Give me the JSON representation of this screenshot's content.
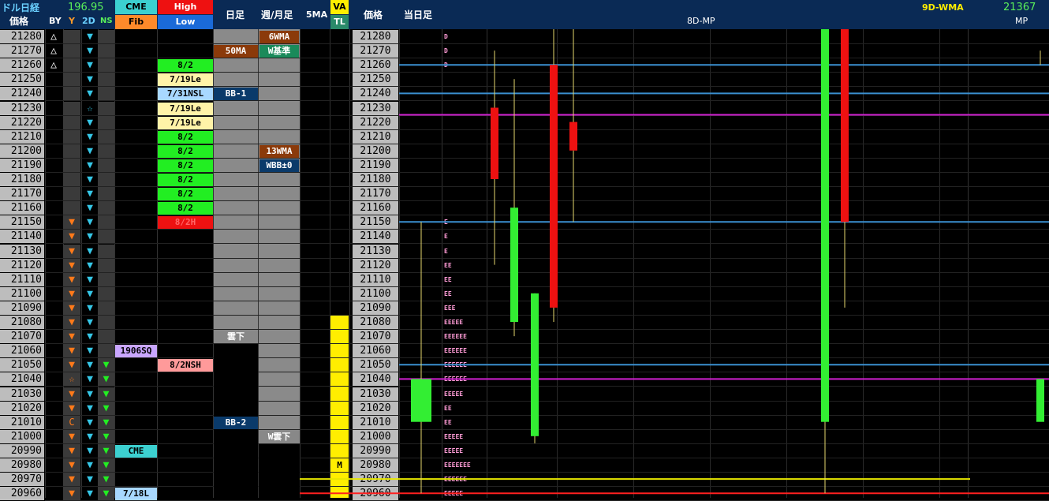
{
  "header": {
    "title": "ドル日経",
    "rate": "196.95",
    "price_label": "価格",
    "by_label": "BY",
    "y_label": "Y",
    "two_d_label": "2D",
    "ns_label": "NS",
    "cme_label": "CME",
    "fib_label": "Fib",
    "high_label": "High",
    "low_label": "Low",
    "daily_label": "日足",
    "weekly_label": "週/月足",
    "ma5_label": "5MA",
    "va_label": "VA",
    "tl_label": "TL",
    "price_label2": "価格",
    "today_label": "当日足",
    "mp8d_label": "8D-MP",
    "wma9d_label": "9D-WMA",
    "mp_value": "21367",
    "mp_label": "MP"
  },
  "prices": [
    "21280",
    "21270",
    "21260",
    "21250",
    "21240",
    "21230",
    "21220",
    "21210",
    "21200",
    "21190",
    "21180",
    "21170",
    "21160",
    "21150",
    "21140",
    "21130",
    "21120",
    "21110",
    "21100",
    "21090",
    "21080",
    "21070",
    "21060",
    "21050",
    "21040",
    "21030",
    "21020",
    "21010",
    "21000",
    "20990",
    "20980",
    "20970",
    "20960"
  ],
  "by_col": [
    "△",
    "△",
    "△",
    "",
    "",
    "",
    "",
    "",
    "",
    "",
    "",
    "",
    "",
    "",
    "",
    "",
    "",
    "",
    "",
    "",
    "",
    "",
    "",
    "",
    "",
    "",
    "",
    "",
    "",
    "",
    "",
    "",
    ""
  ],
  "y_col": [
    "",
    "",
    "",
    "",
    "",
    "",
    "",
    "",
    "",
    "",
    "",
    "",
    "",
    "▼",
    "▼",
    "▼",
    "▼",
    "▼",
    "▼",
    "▼",
    "▼",
    "▼",
    "▼",
    "▼",
    "☆",
    "▼",
    "▼",
    "C",
    "▼",
    "▼",
    "▼",
    "▼",
    "▼"
  ],
  "d2_col": [
    "▼",
    "▼",
    "▼",
    "▼",
    "▼",
    "☆",
    "▼",
    "▼",
    "▼",
    "▼",
    "▼",
    "▼",
    "▼",
    "▼",
    "▼",
    "▼",
    "▼",
    "▼",
    "▼",
    "▼",
    "▼",
    "▼",
    "▼",
    "▼",
    "▼",
    "▼",
    "▼",
    "▼",
    "▼",
    "▼",
    "▼",
    "▼",
    "▼"
  ],
  "ns_col": [
    "",
    "",
    "",
    "",
    "",
    "",
    "",
    "",
    "",
    "",
    "",
    "",
    "",
    "",
    "",
    "",
    "",
    "",
    "",
    "",
    "",
    "",
    "",
    "▼",
    "▼",
    "▼",
    "▼",
    "▼",
    "▼",
    "▼",
    "▼",
    "▼",
    "▼"
  ],
  "cme_col": [
    {
      "row": 22,
      "text": "1906SQ",
      "bg": "#c9a6ff",
      "fg": "#000000"
    },
    {
      "row": 29,
      "text": "CME",
      "bg": "#3cd0d0",
      "fg": "#000000"
    },
    {
      "row": 32,
      "text": "7/18L",
      "bg": "#a8d8ff",
      "fg": "#000000"
    }
  ],
  "hl_col": [
    {
      "row": 2,
      "text": "8/2",
      "bg": "#22ee22",
      "fg": "#000000"
    },
    {
      "row": 3,
      "text": "7/19Le",
      "bg": "#fff3a8",
      "fg": "#000000"
    },
    {
      "row": 4,
      "text": "7/31NSL",
      "bg": "#a8d8ff",
      "fg": "#000000"
    },
    {
      "row": 5,
      "text": "7/19Le",
      "bg": "#fff3a8",
      "fg": "#000000"
    },
    {
      "row": 6,
      "text": "7/19Le",
      "bg": "#fff3a8",
      "fg": "#000000"
    },
    {
      "row": 7,
      "text": "8/2",
      "bg": "#22ee22",
      "fg": "#000000"
    },
    {
      "row": 8,
      "text": "8/2",
      "bg": "#22ee22",
      "fg": "#000000"
    },
    {
      "row": 9,
      "text": "8/2",
      "bg": "#22ee22",
      "fg": "#000000"
    },
    {
      "row": 10,
      "text": "8/2",
      "bg": "#22ee22",
      "fg": "#000000"
    },
    {
      "row": 11,
      "text": "8/2",
      "bg": "#22ee22",
      "fg": "#000000"
    },
    {
      "row": 12,
      "text": "8/2",
      "bg": "#22ee22",
      "fg": "#000000"
    },
    {
      "row": 13,
      "text": "8/2H",
      "bg": "#ee1111",
      "fg": "#ff6666"
    },
    {
      "row": 23,
      "text": "8/2NSH",
      "bg": "#ff9a9a",
      "fg": "#000000"
    }
  ],
  "daily_col": [
    {
      "row": 1,
      "text": "50MA",
      "bg": "#8b3a0a",
      "fg": "#ffffff"
    },
    {
      "row": 4,
      "text": "BB-1",
      "bg": "#0a3a6a",
      "fg": "#ffffff"
    },
    {
      "row": 21,
      "text": "雲下",
      "bg": "#888888",
      "fg": "#ffffff"
    },
    {
      "row": 27,
      "text": "BB-2",
      "bg": "#0a3a6a",
      "fg": "#ffffff"
    }
  ],
  "weekly_col": [
    {
      "row": 0,
      "text": "6WMA",
      "bg": "#8b3a0a",
      "fg": "#ffffff"
    },
    {
      "row": 1,
      "text": "W基準",
      "bg": "#1a8a5a",
      "fg": "#ffffff"
    },
    {
      "row": 8,
      "text": "13WMA",
      "bg": "#8b3a0a",
      "fg": "#ffffff"
    },
    {
      "row": 9,
      "text": "WBB±0",
      "bg": "#0a3a6a",
      "fg": "#ffffff"
    },
    {
      "row": 28,
      "text": "W雲下",
      "bg": "#888888",
      "fg": "#ffffff"
    }
  ],
  "va_col": [
    {
      "row": 30,
      "text": "M"
    }
  ],
  "tpo": [
    {
      "row": 0,
      "text": "D"
    },
    {
      "row": 1,
      "text": "D"
    },
    {
      "row": 2,
      "text": "D"
    },
    {
      "row": 13,
      "text": "E"
    },
    {
      "row": 14,
      "text": "E"
    },
    {
      "row": 15,
      "text": "E"
    },
    {
      "row": 16,
      "text": "EE"
    },
    {
      "row": 17,
      "text": "EE"
    },
    {
      "row": 18,
      "text": "EE"
    },
    {
      "row": 19,
      "text": "EEE"
    },
    {
      "row": 20,
      "text": "EEEEE"
    },
    {
      "row": 21,
      "text": "EEEEEE"
    },
    {
      "row": 22,
      "text": "EEEEEE"
    },
    {
      "row": 23,
      "text": "EEEEEE"
    },
    {
      "row": 24,
      "text": "EEEEEE"
    },
    {
      "row": 25,
      "text": "EEEEE"
    },
    {
      "row": 26,
      "text": "EE"
    },
    {
      "row": 27,
      "text": "EE"
    },
    {
      "row": 28,
      "text": "EEEEE"
    },
    {
      "row": 29,
      "text": "EEEEE"
    },
    {
      "row": 30,
      "text": "EEEEEEE"
    },
    {
      "row": 31,
      "text": "EEEEEE"
    },
    {
      "row": 32,
      "text": "EEEEE"
    }
  ],
  "colors": {
    "up": "#33ee33",
    "down": "#ee1111",
    "wick": "#e6d86e",
    "va_yellow": "#ffee00",
    "line_blue": "#3a8fd0",
    "line_magenta": "#d020d0",
    "line_yellow": "#e8e800",
    "line_red": "#ff2020",
    "sig_orange": "#ff7a1a",
    "sig_cyan": "#36c8e8",
    "sig_green": "#22ee22"
  },
  "hlines": [
    {
      "price": 21260,
      "color": "#3a8fd0"
    },
    {
      "price": 21240,
      "color": "#3a8fd0"
    },
    {
      "price": 21225,
      "color": "#d020d0"
    },
    {
      "price": 21150,
      "color": "#3a8fd0"
    },
    {
      "price": 21050,
      "color": "#3a8fd0"
    },
    {
      "price": 21040,
      "color": "#d020d0"
    },
    {
      "price": 20970,
      "color": "#e8e800"
    },
    {
      "price": 20960,
      "color": "#ff2020"
    }
  ],
  "candles": [
    {
      "x": 1,
      "open": 21040,
      "close": 21010,
      "high": 21150,
      "low": 20960,
      "dir": "up"
    },
    {
      "x": 2,
      "open": 21230,
      "close": 21180,
      "high": 21270,
      "low": 21120,
      "dir": "down"
    },
    {
      "x": 3,
      "open": 21160,
      "close": 21080,
      "high": 21250,
      "low": 21070,
      "dir": "up"
    },
    {
      "x": 4,
      "open": 21100,
      "close": 21000,
      "high": 21100,
      "low": 20995,
      "dir": "up"
    },
    {
      "x": 5,
      "open": 21260,
      "close": 21090,
      "high": 21290,
      "low": 21080,
      "dir": "down"
    },
    {
      "x": 6,
      "open": 21220,
      "close": 21200,
      "high": 21290,
      "low": 21150,
      "dir": "down"
    },
    {
      "x": 7,
      "open": 21290,
      "close": 21010,
      "high": 21290,
      "low": 20960,
      "dir": "up"
    },
    {
      "x": 8,
      "open": 21290,
      "close": 21150,
      "high": 21290,
      "low": 21090,
      "dir": "down"
    },
    {
      "x": 9,
      "open": 21040,
      "close": 21010,
      "high": 21270,
      "low": 21260,
      "dir": "up"
    }
  ]
}
